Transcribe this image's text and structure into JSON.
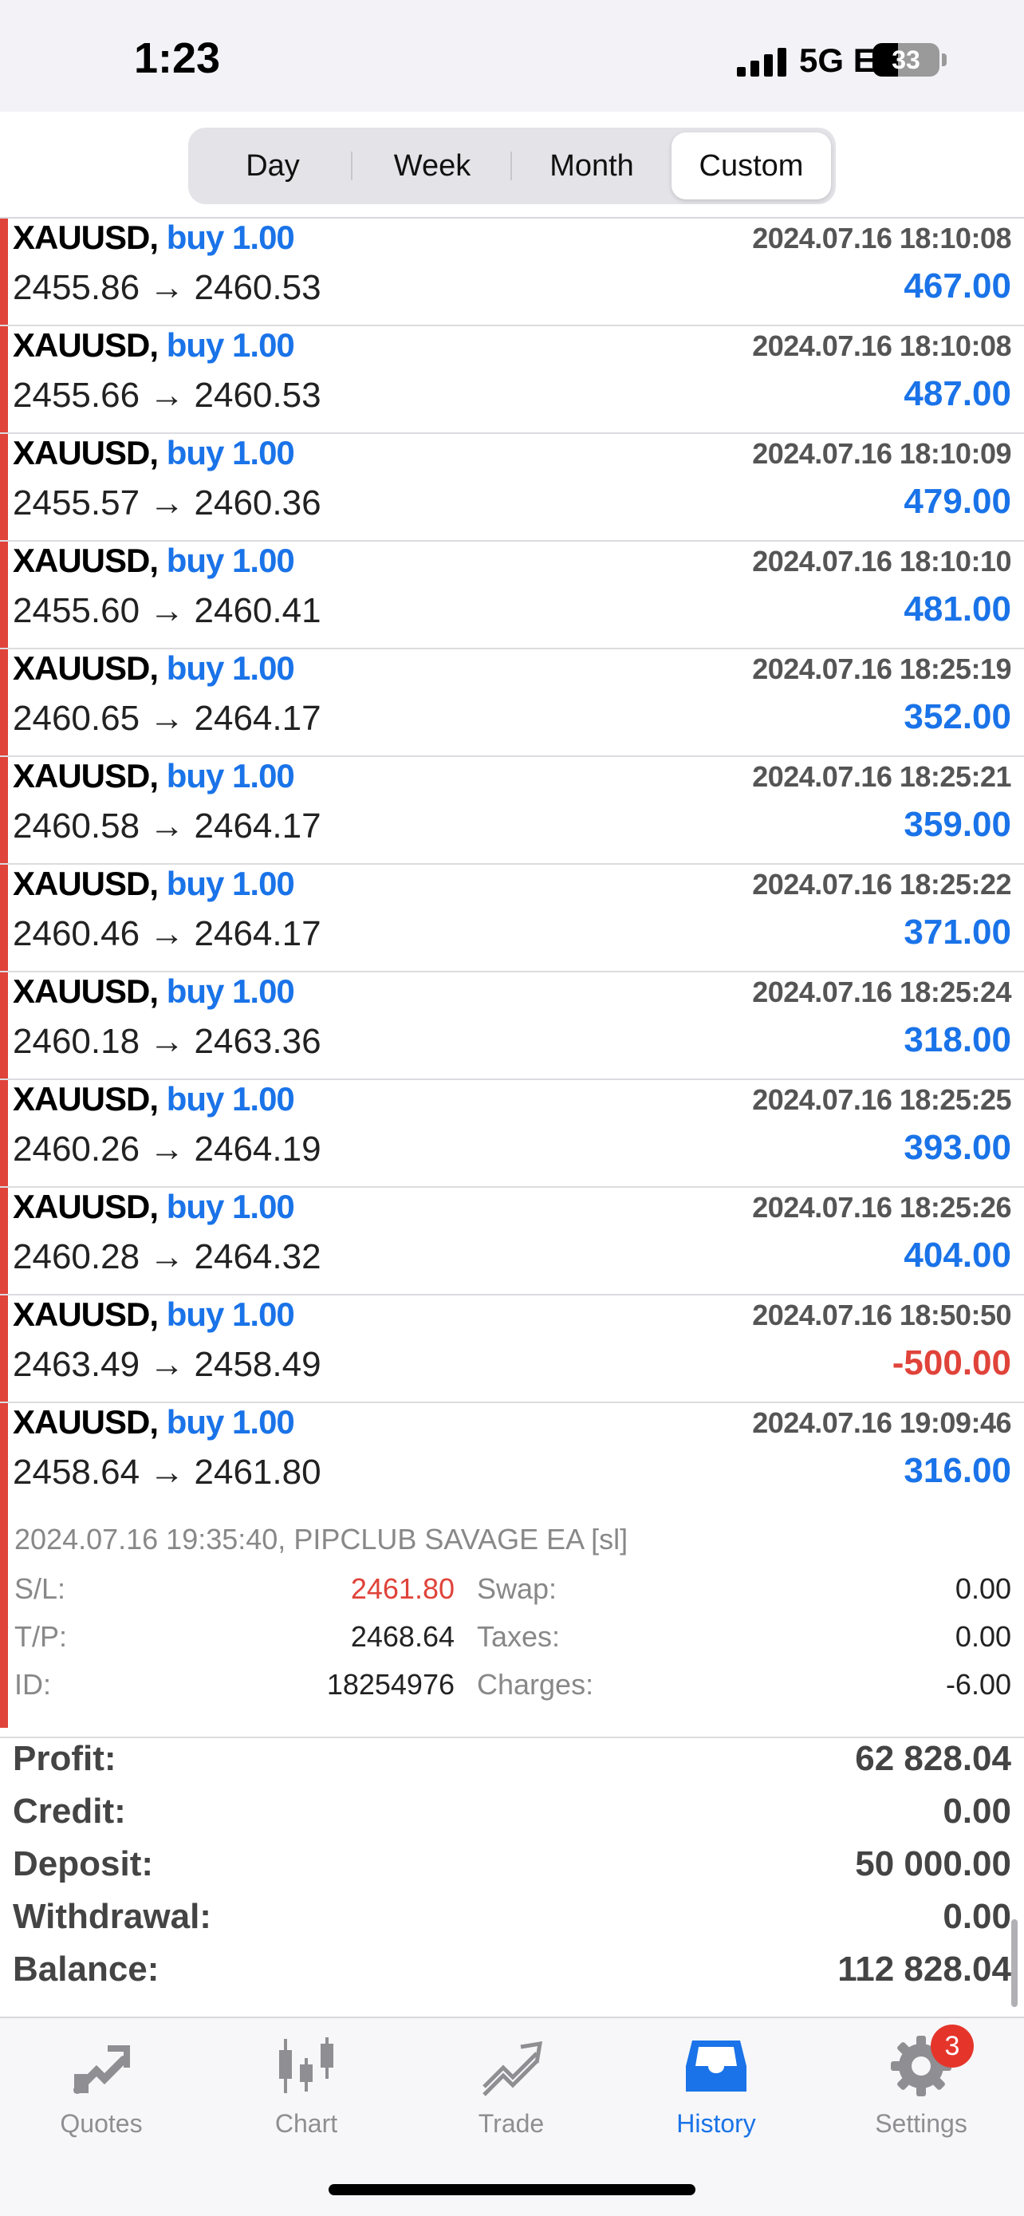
{
  "status": {
    "time": "1:23",
    "network": "5G E",
    "battery": "33"
  },
  "segments": [
    {
      "label": "Day",
      "active": false
    },
    {
      "label": "Week",
      "active": false
    },
    {
      "label": "Month",
      "active": false
    },
    {
      "label": "Custom",
      "active": true
    }
  ],
  "deals": [
    {
      "symbol": "XAUUSD,",
      "direction": "buy 1.00",
      "datetime": "2024.07.16 18:10:08",
      "prices": "2455.86 → 2460.53",
      "profit": "467.00"
    },
    {
      "symbol": "XAUUSD,",
      "direction": "buy 1.00",
      "datetime": "2024.07.16 18:10:08",
      "prices": "2455.66 → 2460.53",
      "profit": "487.00"
    },
    {
      "symbol": "XAUUSD,",
      "direction": "buy 1.00",
      "datetime": "2024.07.16 18:10:09",
      "prices": "2455.57 → 2460.36",
      "profit": "479.00"
    },
    {
      "symbol": "XAUUSD,",
      "direction": "buy 1.00",
      "datetime": "2024.07.16 18:10:10",
      "prices": "2455.60 → 2460.41",
      "profit": "481.00"
    },
    {
      "symbol": "XAUUSD,",
      "direction": "buy 1.00",
      "datetime": "2024.07.16 18:25:19",
      "prices": "2460.65 → 2464.17",
      "profit": "352.00"
    },
    {
      "symbol": "XAUUSD,",
      "direction": "buy 1.00",
      "datetime": "2024.07.16 18:25:21",
      "prices": "2460.58 → 2464.17",
      "profit": "359.00"
    },
    {
      "symbol": "XAUUSD,",
      "direction": "buy 1.00",
      "datetime": "2024.07.16 18:25:22",
      "prices": "2460.46 → 2464.17",
      "profit": "371.00"
    },
    {
      "symbol": "XAUUSD,",
      "direction": "buy 1.00",
      "datetime": "2024.07.16 18:25:24",
      "prices": "2460.18 → 2463.36",
      "profit": "318.00"
    },
    {
      "symbol": "XAUUSD,",
      "direction": "buy 1.00",
      "datetime": "2024.07.16 18:25:25",
      "prices": "2460.26 → 2464.19",
      "profit": "393.00"
    },
    {
      "symbol": "XAUUSD,",
      "direction": "buy 1.00",
      "datetime": "2024.07.16 18:25:26",
      "prices": "2460.28 → 2464.32",
      "profit": "404.00"
    },
    {
      "symbol": "XAUUSD,",
      "direction": "buy 1.00",
      "datetime": "2024.07.16 18:50:50",
      "prices": "2463.49 → 2458.49",
      "profit": "-500.00"
    },
    {
      "symbol": "XAUUSD,",
      "direction": "buy 1.00",
      "datetime": "2024.07.16 19:09:46",
      "prices": "2458.64 → 2461.80",
      "profit": "316.00"
    }
  ],
  "detail": {
    "comment": "2024.07.16 19:35:40, PIPCLUB SAVAGE EA [sl]",
    "sl_label": "S/L:",
    "sl_value": "2461.80",
    "tp_label": "T/P:",
    "tp_value": "2468.64",
    "id_label": "ID:",
    "id_value": "18254976",
    "swap_label": "Swap:",
    "swap_value": "0.00",
    "taxes_label": "Taxes:",
    "taxes_value": "0.00",
    "charges_label": "Charges:",
    "charges_value": "-6.00"
  },
  "summary": [
    {
      "label": "Profit:",
      "value": "62 828.04"
    },
    {
      "label": "Credit:",
      "value": "0.00"
    },
    {
      "label": "Deposit:",
      "value": "50 000.00"
    },
    {
      "label": "Withdrawal:",
      "value": "0.00"
    },
    {
      "label": "Balance:",
      "value": "112 828.04"
    }
  ],
  "tabs": [
    {
      "label": "Quotes",
      "icon": "quotes-icon"
    },
    {
      "label": "Chart",
      "icon": "chart-icon"
    },
    {
      "label": "Trade",
      "icon": "trade-icon"
    },
    {
      "label": "History",
      "icon": "history-icon"
    },
    {
      "label": "Settings",
      "icon": "gear-icon"
    }
  ],
  "settings_badge": "3",
  "colors": {
    "accent": "#1a73e8",
    "loss": "#e0433a",
    "badge": "#e5352b"
  }
}
